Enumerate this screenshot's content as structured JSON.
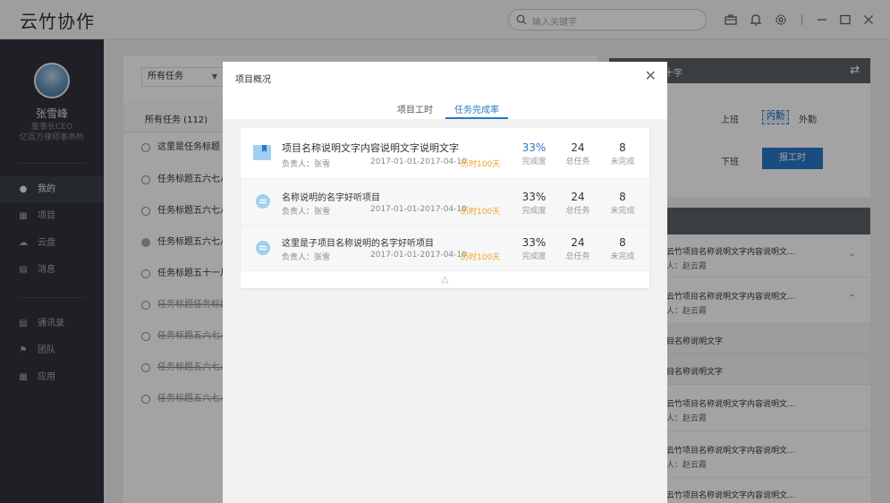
{
  "app": {
    "title": "云竹协作"
  },
  "search": {
    "placeholder": "输入关键字"
  },
  "user": {
    "name": "张雪峰",
    "role": "董事长CEO",
    "company": "亿百万律师事务所"
  },
  "nav": [
    {
      "label": "我的",
      "icon": "person-icon",
      "active": true
    },
    {
      "label": "项目",
      "icon": "project-icon",
      "active": false
    },
    {
      "label": "云盘",
      "icon": "cloud-icon",
      "active": false
    },
    {
      "label": "消息",
      "icon": "message-icon",
      "active": false
    },
    {
      "label": "通讯录",
      "icon": "contacts-icon",
      "active": false
    },
    {
      "label": "团队",
      "icon": "flag-icon",
      "active": false
    },
    {
      "label": "应用",
      "icon": "apps-icon",
      "active": false
    }
  ],
  "tasks_panel": {
    "filter": "所有任务",
    "tab": "所有任务 (112)",
    "tasks": [
      {
        "text": "这里是任务标题"
      },
      {
        "text": "任务标题五六七八"
      },
      {
        "text": "任务标题五六七八"
      },
      {
        "text": "任务标题五六七八"
      },
      {
        "text": "任务标题五十一月"
      },
      {
        "text": "任务标题任务标题"
      },
      {
        "text": "任务标题五六七八"
      },
      {
        "text": "任务标题五六七八"
      },
      {
        "text": "任务标题五六七八"
      }
    ]
  },
  "attendance": {
    "header": "十字",
    "on_duty": "上班",
    "off_duty": "下班",
    "internal": "内勤",
    "field": "外勤",
    "report_button": "报工时"
  },
  "right_list": {
    "item1_title": "云竹项目名称说明文字内容说明文...",
    "item1_owner": "人：赵云霞",
    "item2_title": "云竹项目名称说明文字内容说明文...",
    "item2_owner": "人：赵云霞",
    "sub1": "目名称说明文字",
    "sub2": "目名称说明文字",
    "item3_title": "云竹项目名称说明文字内容说明文...",
    "item3_owner": "人：赵云霞",
    "item4_title": "云竹项目名称说明文字内容说明文...",
    "item4_owner": "人：赵云霞",
    "item5_title": "云竹项目名称说明文字内容说明文..."
  },
  "modal": {
    "title": "项目概况",
    "tabs": [
      "项目工时",
      "任务完成率"
    ],
    "projects": [
      {
        "name": "项目名称说明文字内容说明文字说明文字",
        "owner": "负责人：张雪",
        "dates": "2017-01-01-2017-04-10",
        "duration": "历时100天",
        "completion": "33%",
        "completion_label": "完成度",
        "total": "24",
        "total_label": "总任务",
        "pending": "8",
        "pending_label": "未完成"
      },
      {
        "name": "名称说明的名字好听项目",
        "owner": "负责人：张雪",
        "dates": "2017-01-01-2017-04-10",
        "duration": "历时100天",
        "completion": "33%",
        "completion_label": "完成度",
        "total": "24",
        "total_label": "总任务",
        "pending": "8",
        "pending_label": "未完成"
      },
      {
        "name": "这里是子项目名称说明的名字好听项目",
        "owner": "负责人：张雪",
        "dates": "2017-01-01-2017-04-10",
        "duration": "历时100天",
        "completion": "33%",
        "completion_label": "完成度",
        "total": "24",
        "total_label": "总任务",
        "pending": "8",
        "pending_label": "未完成"
      }
    ]
  },
  "colors": {
    "accent": "#2a77c9",
    "warning": "#f0a020",
    "sidebar": "#2f333a"
  }
}
